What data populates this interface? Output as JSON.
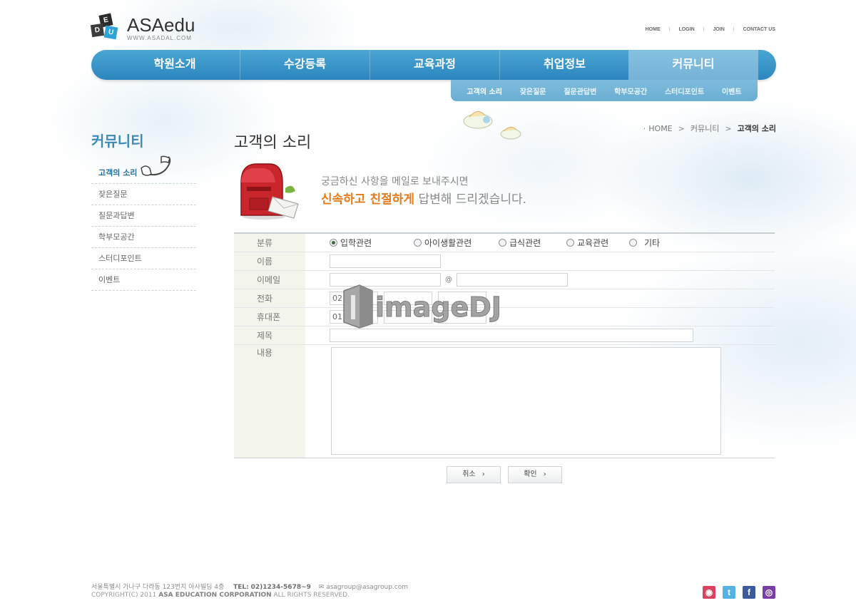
{
  "logo": {
    "wordmark": "ASAedu",
    "url_text": "WWW.ASADAL.COM",
    "tile_letters": [
      "E",
      "D",
      "U"
    ]
  },
  "top_links": [
    "HOME",
    "LOGIN",
    "JOIN",
    "CONTACT US"
  ],
  "gnb": {
    "items": [
      {
        "label": "학원소개"
      },
      {
        "label": "수강등록"
      },
      {
        "label": "교육과정"
      },
      {
        "label": "취업정보"
      },
      {
        "label": "커뮤니티",
        "active": true
      }
    ]
  },
  "subnav": {
    "items": [
      {
        "label": "고객의 소리",
        "active": true
      },
      {
        "label": "잦은질문"
      },
      {
        "label": "질문관답변"
      },
      {
        "label": "학부모공간"
      },
      {
        "label": "스터디포인트"
      },
      {
        "label": "이벤트"
      }
    ]
  },
  "sidebar": {
    "title": "커뮤니티",
    "items": [
      {
        "label": "고객의 소리",
        "active": true
      },
      {
        "label": "잦은질문"
      },
      {
        "label": "질문과답변"
      },
      {
        "label": "학부모공간"
      },
      {
        "label": "스터디포인트"
      },
      {
        "label": "이벤트"
      }
    ]
  },
  "breadcrumb": {
    "items": [
      "HOME",
      "커뮤니티",
      "고객의 소리"
    ]
  },
  "page": {
    "title": "고객의 소리",
    "intro_line1": "궁금하신 사항을 메일로 보내주시면",
    "intro_highlight": "신속하고 친절하게",
    "intro_rest": " 답변해 드리겠습니다."
  },
  "form": {
    "labels": {
      "category": "분류",
      "name": "이름",
      "email": "이메일",
      "phone": "전화",
      "mobile": "휴대폰",
      "subject": "제목",
      "content": "내용"
    },
    "category_options": [
      {
        "label": "입학관련",
        "selected": true
      },
      {
        "label": "아이생활관련",
        "selected": false
      },
      {
        "label": "급식관련",
        "selected": false
      },
      {
        "label": "교육관련",
        "selected": false
      },
      {
        "label": "기타",
        "selected": false
      }
    ],
    "email_at": "@",
    "phone_prefix": "02",
    "mobile_prefix": "01",
    "name_value": "",
    "email_id_value": "",
    "email_domain_value": "",
    "subject_value": "",
    "content_value": ""
  },
  "buttons": {
    "cancel": "취소",
    "confirm": "확인"
  },
  "watermark": "imageDJ",
  "footer": {
    "address": "서울특별시 가나구 다라동 123번지 아사빌딩 4층",
    "tel_label": "TEL:",
    "tel": "02)1234-5678~9",
    "email": "asagroup@asagroup.com",
    "copyright_prefix": "COPYRIGHT(C) 2011 ",
    "company": "ASA EDUCATION CORPORATION",
    "copyright_suffix": " ALL RIGHTS RESERVED."
  },
  "social": [
    {
      "name": "blog-icon",
      "color": "#d9435e"
    },
    {
      "name": "twitter-icon",
      "color": "#55b2e4"
    },
    {
      "name": "facebook-icon",
      "color": "#3b5b9c"
    },
    {
      "name": "me2day-icon",
      "color": "#7a3fa6"
    }
  ],
  "colors": {
    "gnb": "#2b86bf",
    "accent_orange": "#e67a1a",
    "side_title": "#3c8ab8"
  }
}
